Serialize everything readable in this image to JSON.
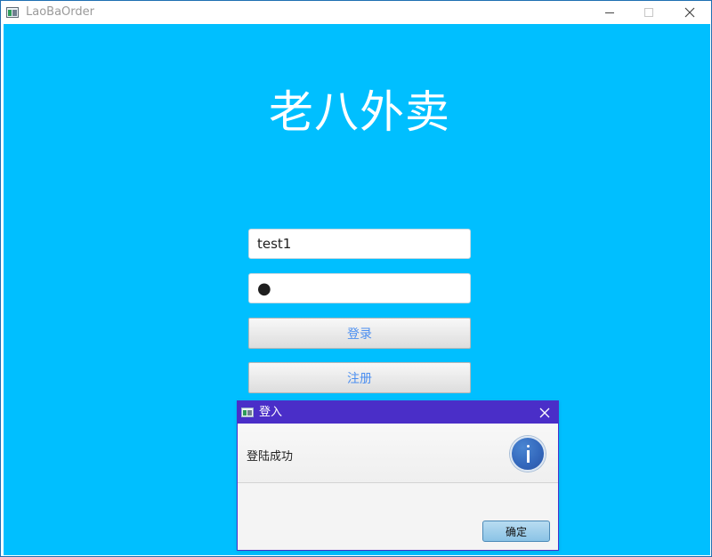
{
  "window": {
    "title": "LaoBaOrder"
  },
  "main": {
    "brand_title": "老八外卖",
    "username": {
      "value": "test1",
      "placeholder": ""
    },
    "password": {
      "masked_value": "●",
      "placeholder": ""
    },
    "buttons": {
      "login": "登录",
      "register": "注册"
    }
  },
  "dialog": {
    "title": "登入",
    "message": "登陆成功",
    "icon": "info-icon",
    "buttons": {
      "ok": "确定"
    }
  },
  "colors": {
    "background": "#00bfff",
    "dialog_title_bar": "#4a2ec8",
    "button_text": "#4c8ff0"
  }
}
